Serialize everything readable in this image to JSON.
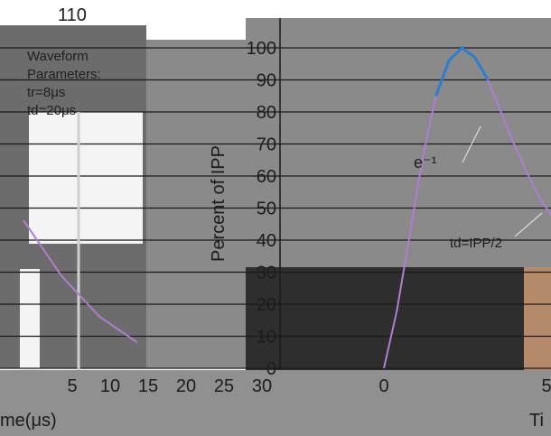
{
  "chart_data": [
    {
      "type": "line",
      "title": "Waveform Parameters:",
      "annotations": [
        "tr=8μs",
        "td=20μs"
      ],
      "xlabel": "Time(μs)",
      "ylabel": "Percent of IPP",
      "xlim": [
        0,
        35
      ],
      "x_ticks": [
        "5",
        "10",
        "15",
        "20",
        "25",
        "30"
      ],
      "y_ticks_visible": [
        "110"
      ],
      "series": [
        {
          "x": [
            0,
            5,
            10,
            15
          ],
          "values": [
            40,
            25,
            14,
            7
          ]
        }
      ]
    },
    {
      "type": "line",
      "ylabel": "Percent of IPP",
      "xlabel": "Ti",
      "ylim": [
        0,
        100
      ],
      "y_ticks": [
        "0",
        "10",
        "20",
        "30",
        "40",
        "50",
        "60",
        "70",
        "80",
        "90",
        "100"
      ],
      "x_ticks": [
        "0",
        "5"
      ],
      "annotations": [
        "e⁻¹",
        "td=IPP/2"
      ],
      "series": [
        {
          "x": [
            0,
            0.4,
            0.8,
            1.2,
            1.6,
            2.0,
            2.4,
            2.8,
            3.2,
            3.6,
            4.0,
            4.4,
            4.8,
            5.2,
            5.6
          ],
          "values": [
            0,
            18,
            42,
            66,
            85,
            96,
            100,
            97,
            90,
            80,
            70,
            61,
            53,
            47,
            43
          ]
        }
      ]
    }
  ],
  "left_panel": {
    "title_line1": "Waveform",
    "title_line2": "Parameters:",
    "tr": "tr=8μs",
    "td": "td=20μs",
    "y_top_label": "110",
    "x_caption": "me(μs)",
    "x_ticks": [
      "5",
      "10",
      "15",
      "20",
      "25",
      "30"
    ]
  },
  "right_panel": {
    "y_caption": "Percent of IPP",
    "y_ticks": [
      "100",
      "90",
      "80",
      "70",
      "60",
      "50",
      "40",
      "30",
      "20",
      "10",
      "0"
    ],
    "annot_e": "e⁻¹",
    "annot_td": "td=IPP/2",
    "x_ticks": [
      "0",
      "5"
    ],
    "x_caption": "Ti"
  }
}
